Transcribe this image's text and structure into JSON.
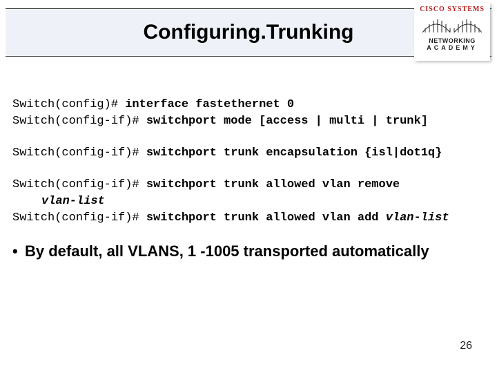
{
  "header": {
    "title": "Configuring.Trunking"
  },
  "logo": {
    "brand": "CISCO SYSTEMS",
    "sub1": "NETWORKING",
    "sub2": "ACADEMY"
  },
  "cli": {
    "block1": {
      "l1_prompt": "Switch(config)# ",
      "l1_cmd": "interface fastethernet 0",
      "l2_prompt": "Switch(config-if)# ",
      "l2_cmd": "switchport mode [access | multi | trunk]"
    },
    "block2": {
      "l1_prompt": "Switch(config-if)# ",
      "l1_cmd": "switchport trunk encapsulation {isl|dot1q}"
    },
    "block3": {
      "l1_prompt": "Switch(config-if)# ",
      "l1_cmd": "switchport trunk allowed vlan remove ",
      "l1_arg": "vlan-list",
      "l2_prompt": "Switch(config-if)# ",
      "l2_cmd": "switchport trunk allowed vlan add ",
      "l2_arg": "vlan-list"
    }
  },
  "bullet": {
    "text": "By default, all VLANS, 1 -1005 transported automatically"
  },
  "page": {
    "number": "26"
  }
}
